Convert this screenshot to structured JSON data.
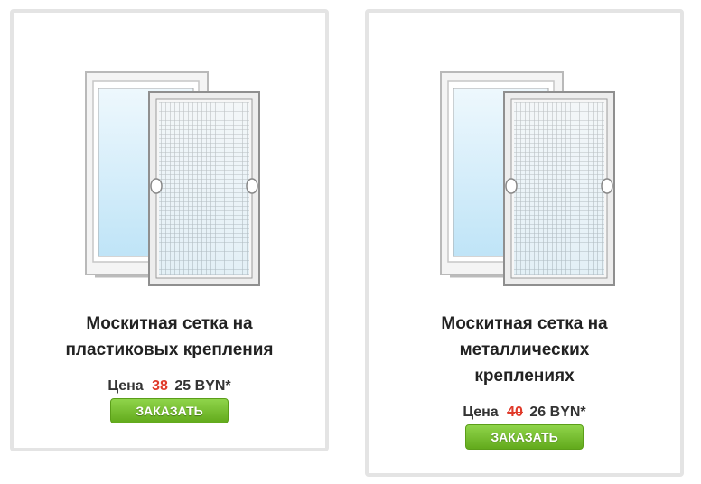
{
  "products": [
    {
      "title_line1": "Москитная сетка на",
      "title_line2": "пластиковых крепления",
      "title_line3": "",
      "price_label": "Цена",
      "price_old": "38",
      "price_new": "25 BYN*",
      "order_label": "ЗАКАЗАТЬ",
      "image_icon": "window-with-mosquito-net-icon"
    },
    {
      "title_line1": "Москитная сетка на",
      "title_line2": "металлических",
      "title_line3": "креплениях",
      "price_label": "Цена",
      "price_old": "40",
      "price_new": "26 BYN*",
      "order_label": "ЗАКАЗАТЬ",
      "image_icon": "window-with-mosquito-net-icon"
    }
  ],
  "colors": {
    "button_green": "#6fba24",
    "old_price_red": "#e03a2a",
    "card_border": "#e4e4e4",
    "glass_blue": "#d4eefb"
  }
}
